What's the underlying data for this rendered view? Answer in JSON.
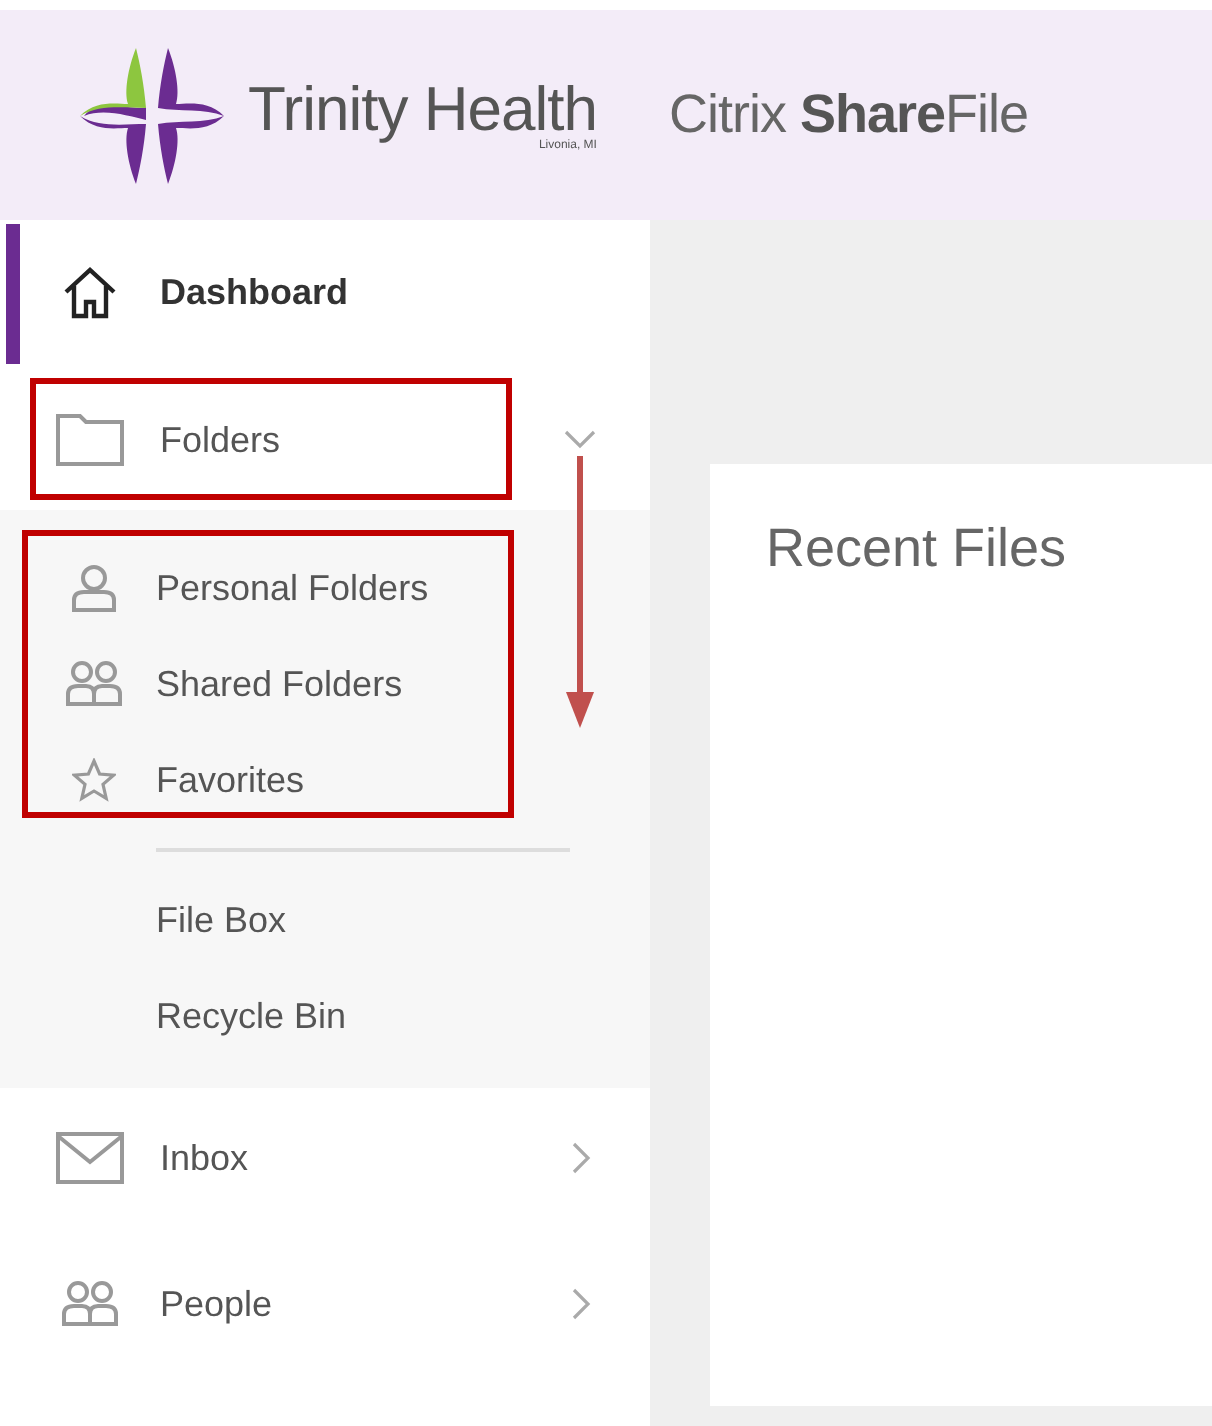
{
  "header": {
    "brand": "Trinity Health",
    "brand_location": "Livonia, MI",
    "product": "Citrix **Share**File"
  },
  "sidebar": {
    "items": [
      {
        "label": "Dashboard",
        "selected": true
      },
      {
        "label": "Folders",
        "selected": false,
        "expanded": true,
        "groups": [
          [
            {
              "label": "Personal Folders"
            },
            {
              "label": "Shared Folders"
            },
            {
              "label": "Favorites"
            }
          ],
          [
            {
              "label": "File Box"
            },
            {
              "label": "Recycle Bin"
            }
          ]
        ]
      },
      {
        "label": "Inbox",
        "selected": false,
        "expanded": false
      },
      {
        "label": "People",
        "selected": false,
        "expanded": false
      }
    ]
  },
  "main": {
    "title": "Recent Files"
  },
  "annotations": [
    {
      "kind": "box",
      "color": "#c00000"
    },
    {
      "kind": "box",
      "color": "#c00000"
    },
    {
      "kind": "arrow",
      "color": "#c0504d"
    }
  ]
}
